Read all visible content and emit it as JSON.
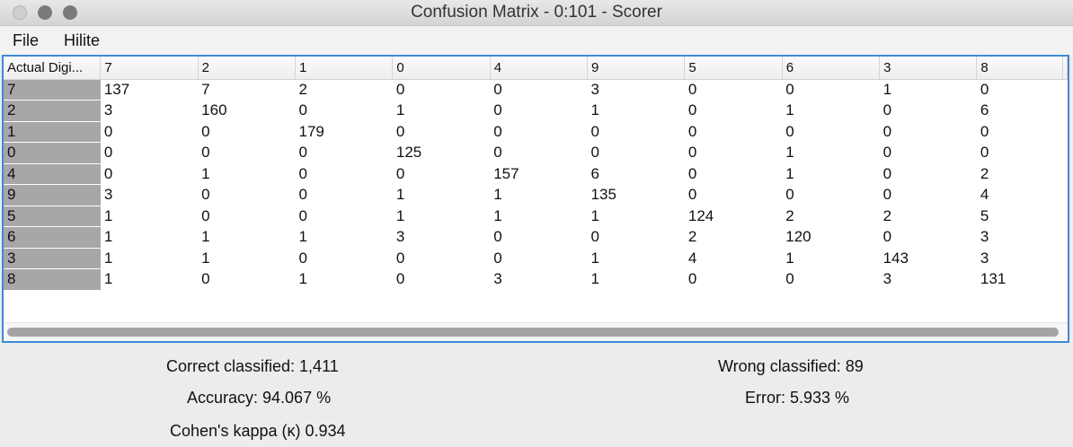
{
  "window": {
    "title": "Confusion Matrix - 0:101 - Scorer"
  },
  "menu": {
    "file": "File",
    "hilite": "Hilite"
  },
  "table": {
    "corner_header": "Actual Digi...",
    "columns": [
      "7",
      "2",
      "1",
      "0",
      "4",
      "9",
      "5",
      "6",
      "3",
      "8"
    ],
    "rows": [
      {
        "label": "7",
        "values": [
          "137",
          "7",
          "2",
          "0",
          "0",
          "3",
          "0",
          "0",
          "1",
          "0"
        ]
      },
      {
        "label": "2",
        "values": [
          "3",
          "160",
          "0",
          "1",
          "0",
          "1",
          "0",
          "1",
          "0",
          "6"
        ]
      },
      {
        "label": "1",
        "values": [
          "0",
          "0",
          "179",
          "0",
          "0",
          "0",
          "0",
          "0",
          "0",
          "0"
        ]
      },
      {
        "label": "0",
        "values": [
          "0",
          "0",
          "0",
          "125",
          "0",
          "0",
          "0",
          "1",
          "0",
          "0"
        ]
      },
      {
        "label": "4",
        "values": [
          "0",
          "1",
          "0",
          "0",
          "157",
          "6",
          "0",
          "1",
          "0",
          "2"
        ]
      },
      {
        "label": "9",
        "values": [
          "3",
          "0",
          "0",
          "1",
          "1",
          "135",
          "0",
          "0",
          "0",
          "4"
        ]
      },
      {
        "label": "5",
        "values": [
          "1",
          "0",
          "0",
          "1",
          "1",
          "1",
          "124",
          "2",
          "2",
          "5"
        ]
      },
      {
        "label": "6",
        "values": [
          "1",
          "1",
          "1",
          "3",
          "0",
          "0",
          "2",
          "120",
          "0",
          "3"
        ]
      },
      {
        "label": "3",
        "values": [
          "1",
          "1",
          "0",
          "0",
          "0",
          "1",
          "4",
          "1",
          "143",
          "3"
        ]
      },
      {
        "label": "8",
        "values": [
          "1",
          "0",
          "1",
          "0",
          "3",
          "1",
          "0",
          "0",
          "3",
          "131"
        ]
      }
    ]
  },
  "stats": {
    "correct": "Correct classified: 1,411",
    "wrong": "Wrong classified: 89",
    "accuracy": "Accuracy: 94.067 %",
    "error": "Error: 5.933 %",
    "kappa": "Cohen's kappa (κ) 0.934"
  }
}
